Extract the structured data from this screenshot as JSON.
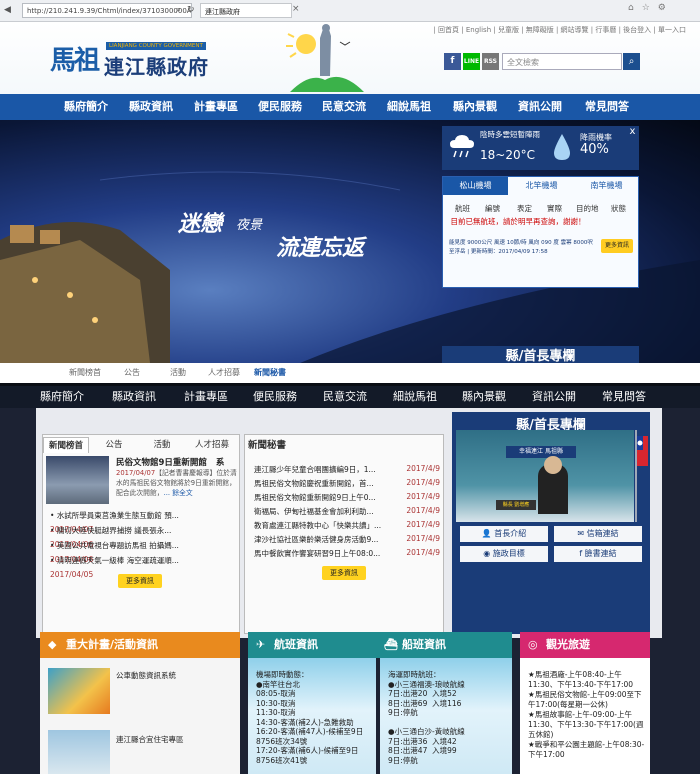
{
  "browser": {
    "url": "http://210.241.9.39/Chtml/index/3710300000A",
    "tab_title": "連江縣政府"
  },
  "header": {
    "top_links": "| 回首頁 | English | 兒童版 | 無障礙版 | 網站導覽 | 行事曆 | 後台登入 | 單一入口",
    "logo_mark": "馬祖",
    "logo_en": "LIANJIANG COUNTY GOVERNMENT",
    "logo_zh": "連江縣政府",
    "search_placeholder": "全文檢索",
    "social": [
      "f",
      "LINE",
      "RSS"
    ]
  },
  "nav": [
    "縣府簡介",
    "縣政資訊",
    "計畫專區",
    "便民服務",
    "民意交流",
    "細說馬祖",
    "縣內景觀",
    "資訊公開",
    "常見問答"
  ],
  "hero": {
    "slogan1": "迷戀",
    "slogan1b": "夜景",
    "slogan2": "流連忘返",
    "weather_text": "陰時多雲短暫陣雨",
    "weather_temp": "18~20°C",
    "rain_label": "降雨機率",
    "rain_val": "40%",
    "close": "x"
  },
  "flight_widget": {
    "tabs": [
      "松山機場",
      "北竿機場",
      "南竿機場"
    ],
    "cols": [
      "航班",
      "編號",
      "表定",
      "實際",
      "目的地",
      "狀態"
    ],
    "msg": "目前已無航班，請於明早再查詢，謝謝！",
    "info": "能見度 9000公尺  風速 10節/時  風向 090 度  雲幂 8000呎  至浮岳 | 更新時間：2017/04/09 17:58",
    "more": "更多資訊"
  },
  "column_peek": "縣/首長專欄",
  "news_tabs_top": [
    "新聞榜首",
    "公告",
    "活動",
    "人才招募",
    "新聞秘書"
  ],
  "news": {
    "tabs": [
      "新聞榜首",
      "公告",
      "活動",
      "人才招募"
    ],
    "feature_title": "民俗文物館9日重新開館",
    "feature_extra": "系",
    "feature_date": "2017/04/07",
    "feature_sub": "【記者曹書慶報導】位於清水的馬祖民俗文物館將於9日重新開館，配合此次開館，",
    "feature_more": "... 餘全文",
    "items": [
      {
        "title": "水試所學員東莒漁業生態互動館",
        "extra": "預...",
        "date": "2017/04/07"
      },
      {
        "title": "關切大陸快艇越界捕撈",
        "extra": "議長張永...",
        "date": "2017/04/06"
      },
      {
        "title": "美國公共電視台專題訪馬祖",
        "extra": "拍攝媽...",
        "date": "2017/04/06"
      },
      {
        "title": "清明連假天氣一級棒",
        "extra": "海空運疏運順...",
        "date": "2017/04/05"
      }
    ],
    "more": "更多資訊"
  },
  "secretary": {
    "title": "新聞秘書",
    "items": [
      {
        "title": "連江縣少年兒童合唱團擴編9日，1...",
        "date": "2017/4/9"
      },
      {
        "title": "馬祖民俗文物館慶祝重新開館，首...",
        "date": "2017/4/9"
      },
      {
        "title": "馬祖民俗文物館重新開館9日上午0...",
        "date": "2017/4/9"
      },
      {
        "title": "衛福局、伊甸社福基金會加利利助...",
        "date": "2017/4/9"
      },
      {
        "title": "教育處連江縣特教中心「快樂共讀」...",
        "date": "2017/4/9"
      },
      {
        "title": "津沙社協社區樂齡樂活健身房活動9...",
        "date": "2017/4/9"
      },
      {
        "title": "馬中餐飲實作饗宴研習9日上午08:0...",
        "date": "2017/4/9"
      }
    ],
    "more": "更多資訊"
  },
  "column": {
    "title": "縣/首長專欄",
    "photo_caption": "縣長 劉增應",
    "photo_banner": "幸福連江 馬祖縣",
    "buttons": [
      "首長介紹",
      "信箱連結",
      "施政目標",
      "臉書連結"
    ]
  },
  "sections": {
    "plans": {
      "title": "重大計畫/活動資訊",
      "items": [
        "公車動態資訊系統",
        "連江縣合宜住宅專區"
      ]
    },
    "flights": {
      "title": "航班資訊",
      "text": "機場即時動態：\n●南竿往台北\n08:05-取消\n10:30-取消\n11:30-取消\n14:30-客滿(補2人)-急難救助\n16:20-客滿(補47人)-候補至9日\n8756班次34號\n17:20-客滿(補6人)-候補至9日\n8756班次41號"
    },
    "ships": {
      "title": "船班資訊",
      "text": "海運即時航班：\n●小三通福澳-琅岐航線\n7日:出港20  入境52\n8日:出港69  入境116\n9日:停航\n\n●小三通白沙-黃岐航線\n7日:出港36  入境42\n8日:出港47  入境99\n9日:停航"
    },
    "tourism": {
      "title": "觀光旅遊",
      "text": "★馬祖酒廠-上午08:40-上午11:30、下午13:40-下午17:00\n★馬祖民俗文物館-上午09:00至下午17:00(每星期一公休)\n★馬祖故事館-上午-09:00-上午11:30、下午13:30-下午17:00(週五休館)\n★戰爭和平公園主題館-上午08:30-下午17:00"
    }
  },
  "colors": {
    "brand": "#1a57a7",
    "dark_navy": "#1a3c78",
    "orange": "#e98a1e",
    "teal": "#1f8c8f",
    "pink": "#d6286f",
    "yellow": "#ffd21f"
  }
}
